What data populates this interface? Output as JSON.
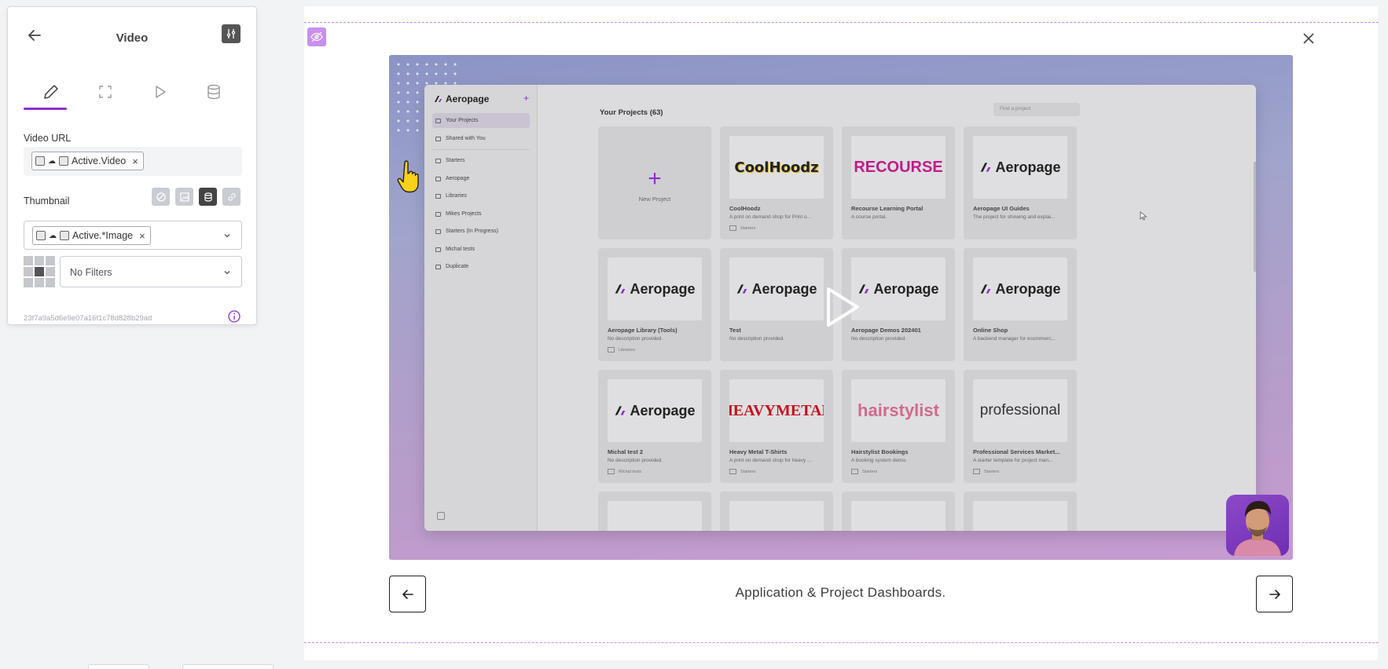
{
  "panel": {
    "title": "Video",
    "video_url_label": "Video URL",
    "video_url_tag": "Active.Video",
    "thumbnail_label": "Thumbnail",
    "thumbnail_tag": "Active.*Image",
    "filters_value": "No Filters",
    "element_id": "23f7a9a5d6e9e07a16f1c78d828b29ad",
    "accent_color": "#8e2fd1"
  },
  "video": {
    "caption": "Application & Project Dashboards.",
    "app": {
      "brand": "Aeropage",
      "nav": [
        {
          "label": "Your Projects",
          "active": true
        },
        {
          "label": "Shared with You",
          "active": false
        },
        {
          "label": "Starters",
          "active": false
        },
        {
          "label": "Aeropage",
          "active": false
        },
        {
          "label": "Libraries",
          "active": false
        },
        {
          "label": "Mikes Projects",
          "active": false
        },
        {
          "label": "Starters (In Progress)",
          "active": false
        },
        {
          "label": "Michal tests",
          "active": false
        },
        {
          "label": "Duplicate",
          "active": false
        }
      ],
      "heading": "Your Projects (63)",
      "search_placeholder": "Find a project",
      "new_project_label": "New Project",
      "cards": [
        {
          "logo": "CoolHoodz",
          "title": "CoolHoodz",
          "desc": "A print on demand shop for Print o...",
          "folder": "Starters"
        },
        {
          "logo": "RECOURSE",
          "title": "Recourse Learning Portal",
          "desc": "A course portal.",
          "folder": ""
        },
        {
          "logo": "Aeropage",
          "title": "Aeropage UI Guides",
          "desc": "The project for showing and explai...",
          "folder": ""
        },
        {
          "logo": "Aeropage",
          "title": "Aeropage Library (Tools)",
          "desc": "No description provided.",
          "folder": "Libraries"
        },
        {
          "logo": "Aeropage",
          "title": "Test",
          "desc": "No description provided.",
          "folder": ""
        },
        {
          "logo": "Aeropage",
          "title": "Aeropage Demos 202401",
          "desc": "No description provided.",
          "folder": ""
        },
        {
          "logo": "Aeropage",
          "title": "Online Shop",
          "desc": "A backend manager for ecommerc...",
          "folder": ""
        },
        {
          "logo": "Aeropage",
          "title": "Michal test 2",
          "desc": "No description provided.",
          "folder": "Michal tests"
        },
        {
          "logo": "HEAVYMETAL",
          "title": "Heavy Metal T-Shirts",
          "desc": "A print on demand shop for heavy ...",
          "folder": "Starters"
        },
        {
          "logo": "hairstylist",
          "title": "Hairstylist Bookings",
          "desc": "A booking system demo.",
          "folder": "Starters"
        },
        {
          "logo": "professional",
          "title": "Professional Services Market...",
          "desc": "A starter template for project man...",
          "folder": "Starters"
        }
      ]
    }
  }
}
